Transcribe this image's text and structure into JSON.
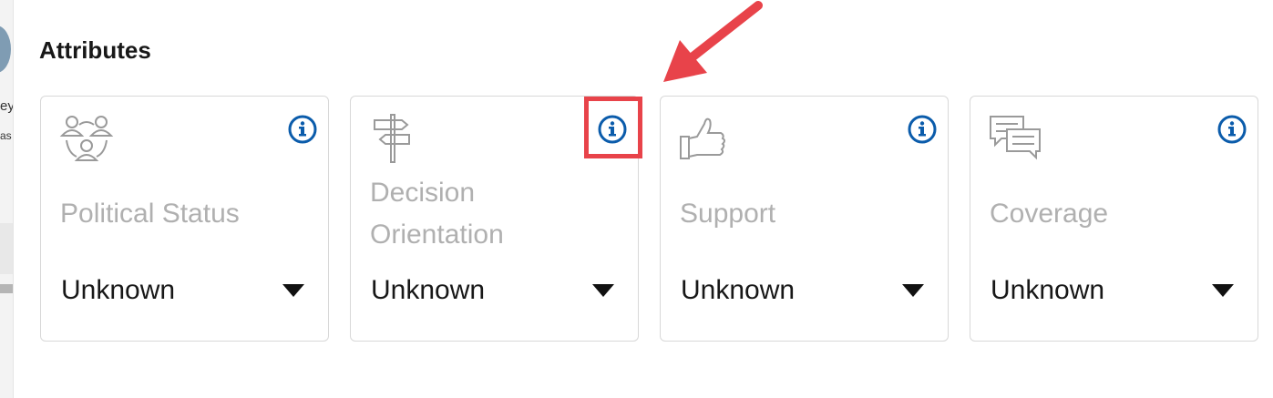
{
  "background": {
    "frag_line1": "ey",
    "frag_line2": "as"
  },
  "section_title": "Attributes",
  "cards": [
    {
      "label": "Political Status",
      "value": "Unknown",
      "icon": "people-network-icon"
    },
    {
      "label": "Decision Orientation",
      "value": "Unknown",
      "icon": "signpost-icon"
    },
    {
      "label": "Support",
      "value": "Unknown",
      "icon": "thumbs-up-icon"
    },
    {
      "label": "Coverage",
      "value": "Unknown",
      "icon": "chat-bubbles-icon"
    }
  ],
  "colors": {
    "info_blue": "#0b5cab",
    "label_gray": "#b0b0b0",
    "annotation_red": "#e8434a",
    "card_border": "#d8d8d8"
  }
}
